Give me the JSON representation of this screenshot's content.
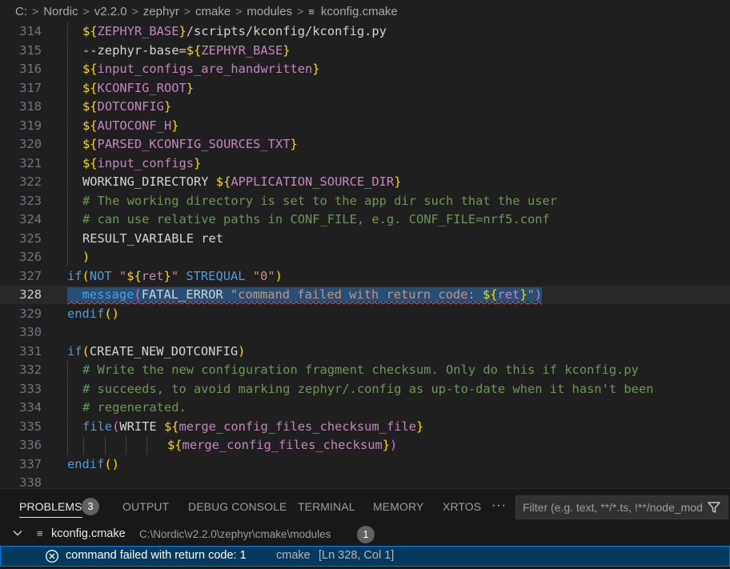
{
  "breadcrumb": {
    "items": [
      "C:",
      "Nordic",
      "v2.2.0",
      "zephyr",
      "cmake",
      "modules",
      "kconfig.cmake"
    ],
    "separator": ">",
    "file_icon": "lines-file-icon"
  },
  "editor": {
    "current_line": 328,
    "lines": [
      {
        "n": "314",
        "indent": 1,
        "tokens": [
          {
            "t": "${",
            "c": "br"
          },
          {
            "t": "ZEPHYR_BASE",
            "c": "var"
          },
          {
            "t": "}",
            "c": "br"
          },
          {
            "t": "/scripts/kconfig/kconfig.py",
            "c": "def"
          }
        ]
      },
      {
        "n": "315",
        "indent": 1,
        "tokens": [
          {
            "t": "--zephyr-base=",
            "c": "def"
          },
          {
            "t": "${",
            "c": "br"
          },
          {
            "t": "ZEPHYR_BASE",
            "c": "var"
          },
          {
            "t": "}",
            "c": "br"
          }
        ]
      },
      {
        "n": "316",
        "indent": 1,
        "tokens": [
          {
            "t": "${",
            "c": "br"
          },
          {
            "t": "input_configs_are_handwritten",
            "c": "var"
          },
          {
            "t": "}",
            "c": "br"
          }
        ]
      },
      {
        "n": "317",
        "indent": 1,
        "tokens": [
          {
            "t": "${",
            "c": "br"
          },
          {
            "t": "KCONFIG_ROOT",
            "c": "var"
          },
          {
            "t": "}",
            "c": "br"
          }
        ]
      },
      {
        "n": "318",
        "indent": 1,
        "tokens": [
          {
            "t": "${",
            "c": "br"
          },
          {
            "t": "DOTCONFIG",
            "c": "var"
          },
          {
            "t": "}",
            "c": "br"
          }
        ]
      },
      {
        "n": "319",
        "indent": 1,
        "tokens": [
          {
            "t": "${",
            "c": "br"
          },
          {
            "t": "AUTOCONF_H",
            "c": "var"
          },
          {
            "t": "}",
            "c": "br"
          }
        ]
      },
      {
        "n": "320",
        "indent": 1,
        "tokens": [
          {
            "t": "${",
            "c": "br"
          },
          {
            "t": "PARSED_KCONFIG_SOURCES_TXT",
            "c": "var"
          },
          {
            "t": "}",
            "c": "br"
          }
        ]
      },
      {
        "n": "321",
        "indent": 1,
        "tokens": [
          {
            "t": "${",
            "c": "br"
          },
          {
            "t": "input_configs",
            "c": "var"
          },
          {
            "t": "}",
            "c": "br"
          }
        ]
      },
      {
        "n": "322",
        "indent": 1,
        "tokens": [
          {
            "t": "WORKING_DIRECTORY ",
            "c": "def"
          },
          {
            "t": "${",
            "c": "br"
          },
          {
            "t": "APPLICATION_SOURCE_DIR",
            "c": "var"
          },
          {
            "t": "}",
            "c": "br"
          }
        ]
      },
      {
        "n": "323",
        "indent": 1,
        "tokens": [
          {
            "t": "# The working directory is set to the app dir such that the user",
            "c": "cmt"
          }
        ]
      },
      {
        "n": "324",
        "indent": 1,
        "tokens": [
          {
            "t": "# can use relative paths in CONF_FILE, e.g. CONF_FILE=nrf5.conf",
            "c": "cmt"
          }
        ]
      },
      {
        "n": "325",
        "indent": 1,
        "tokens": [
          {
            "t": "RESULT_VARIABLE ret",
            "c": "def"
          }
        ]
      },
      {
        "n": "326",
        "indent": 1,
        "tokens": [
          {
            "t": ")",
            "c": "br"
          }
        ]
      },
      {
        "n": "327",
        "indent": 0,
        "tokens": [
          {
            "t": "if",
            "c": "kw"
          },
          {
            "t": "(",
            "c": "br"
          },
          {
            "t": "NOT ",
            "c": "kw"
          },
          {
            "t": "\"",
            "c": "str"
          },
          {
            "t": "${",
            "c": "br"
          },
          {
            "t": "ret",
            "c": "var"
          },
          {
            "t": "}",
            "c": "br"
          },
          {
            "t": "\"",
            "c": "str"
          },
          {
            "t": " STREQUAL ",
            "c": "kw"
          },
          {
            "t": "\"0\"",
            "c": "str"
          },
          {
            "t": ")",
            "c": "br"
          }
        ]
      },
      {
        "n": "328",
        "indent": 0,
        "error": true,
        "tokens": [
          {
            "t": "··",
            "c": "ws"
          },
          {
            "t": "message",
            "c": "kw"
          },
          {
            "t": "(",
            "c": "paren"
          },
          {
            "t": "FATAL_ERROR ",
            "c": "def"
          },
          {
            "t": "\"command failed with return code: ",
            "c": "str"
          },
          {
            "t": "${",
            "c": "br"
          },
          {
            "t": "ret",
            "c": "var"
          },
          {
            "t": "}",
            "c": "br"
          },
          {
            "t": "\"",
            "c": "str"
          },
          {
            "t": ")",
            "c": "paren"
          }
        ]
      },
      {
        "n": "329",
        "indent": 0,
        "tokens": [
          {
            "t": "endif",
            "c": "kw"
          },
          {
            "t": "()",
            "c": "br"
          }
        ]
      },
      {
        "n": "330",
        "indent": 0,
        "tokens": []
      },
      {
        "n": "331",
        "indent": 0,
        "tokens": [
          {
            "t": "if",
            "c": "kw"
          },
          {
            "t": "(",
            "c": "br"
          },
          {
            "t": "CREATE_NEW_DOTCONFIG",
            "c": "def"
          },
          {
            "t": ")",
            "c": "br"
          }
        ]
      },
      {
        "n": "332",
        "indent": 1,
        "tokens": [
          {
            "t": "# Write the new configuration fragment checksum. Only do this if kconfig.py",
            "c": "cmt"
          }
        ]
      },
      {
        "n": "333",
        "indent": 1,
        "tokens": [
          {
            "t": "# succeeds, to avoid marking zephyr/.config as up-to-date when it hasn't been",
            "c": "cmt"
          }
        ]
      },
      {
        "n": "334",
        "indent": 1,
        "tokens": [
          {
            "t": "# regenerated.",
            "c": "cmt"
          }
        ]
      },
      {
        "n": "335",
        "indent": 1,
        "tokens": [
          {
            "t": "file",
            "c": "kw"
          },
          {
            "t": "(",
            "c": "paren"
          },
          {
            "t": "WRITE ",
            "c": "def"
          },
          {
            "t": "${",
            "c": "br"
          },
          {
            "t": "merge_config_files_checksum_file",
            "c": "var"
          },
          {
            "t": "}",
            "c": "br"
          }
        ]
      },
      {
        "n": "336",
        "indent": 6,
        "tokens": [
          {
            "t": "${",
            "c": "br"
          },
          {
            "t": "merge_config_files_checksum",
            "c": "var"
          },
          {
            "t": "}",
            "c": "br"
          },
          {
            "t": ")",
            "c": "paren"
          }
        ]
      },
      {
        "n": "337",
        "indent": 0,
        "tokens": [
          {
            "t": "endif",
            "c": "kw"
          },
          {
            "t": "()",
            "c": "br"
          }
        ]
      },
      {
        "n": "338",
        "indent": 0,
        "tokens": []
      }
    ]
  },
  "panel": {
    "tabs": [
      {
        "label": "PROBLEMS",
        "active": true
      },
      {
        "label": "OUTPUT",
        "active": false
      },
      {
        "label": "DEBUG CONSOLE",
        "active": false
      },
      {
        "label": "TERMINAL",
        "active": false
      },
      {
        "label": "MEMORY",
        "active": false
      },
      {
        "label": "XRTOS",
        "active": false
      }
    ],
    "problems_count": "3",
    "more_label": "···",
    "filter_placeholder": "Filter (e.g. text, **/*.ts, !**/node_modules/**)",
    "file_group": {
      "name": "kconfig.cmake",
      "path": "C:\\Nordic\\v2.2.0\\zephyr\\cmake\\modules",
      "count": "1"
    },
    "problem": {
      "message": "command failed with return code: 1",
      "source": "cmake",
      "location": "[Ln 328, Col 1]"
    }
  },
  "colors": {
    "keyword": "#569cd6",
    "variable": "#c586c0",
    "string": "#ce9178",
    "comment": "#6a9955",
    "bracket": "#ffd700",
    "error": "#f14c4c",
    "selection": "#04395e"
  }
}
